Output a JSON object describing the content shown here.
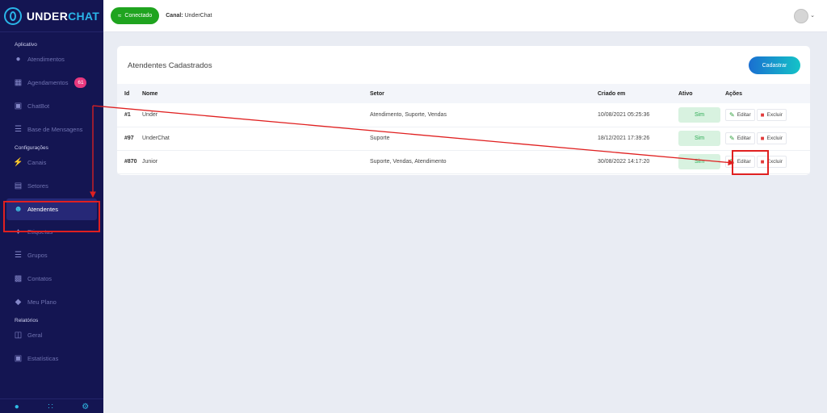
{
  "brand": {
    "part1": "UNDER",
    "part2": "CHAT"
  },
  "sidebar": {
    "sections": [
      {
        "title": "Aplicativo",
        "items": [
          {
            "label": "Atendimentos",
            "icon": "chat-icon"
          },
          {
            "label": "Agendamentos",
            "icon": "calendar-icon",
            "badge": "61"
          },
          {
            "label": "ChatBot",
            "icon": "robot-icon"
          },
          {
            "label": "Base de Mensagens",
            "icon": "database-icon"
          }
        ]
      },
      {
        "title": "Configurações",
        "items": [
          {
            "label": "Canais",
            "icon": "plug-icon"
          },
          {
            "label": "Setores",
            "icon": "server-icon"
          },
          {
            "label": "Atendentes",
            "icon": "user-icon",
            "active": true
          },
          {
            "label": "Etiquetas",
            "icon": "tags-icon"
          },
          {
            "label": "Grupos",
            "icon": "layers-icon"
          },
          {
            "label": "Contatos",
            "icon": "contact-card-icon"
          },
          {
            "label": "Meu Plano",
            "icon": "tag-icon"
          }
        ]
      },
      {
        "title": "Relatórios",
        "items": [
          {
            "label": "Geral",
            "icon": "presentation-icon"
          },
          {
            "label": "Estatísticas",
            "icon": "clipboard-icon"
          }
        ]
      }
    ]
  },
  "topbar": {
    "status_label": "Conectado",
    "channel_prefix": "Canal:",
    "channel_name": "UnderChat"
  },
  "card": {
    "title": "Atendentes Cadastrados",
    "add_button": "Cadastrar"
  },
  "table": {
    "headers": [
      "Id",
      "Nome",
      "Setor",
      "Criado em",
      "Ativo",
      "Ações"
    ],
    "rows": [
      {
        "id": "#1",
        "nome": "Under",
        "setor": "Atendimento, Suporte, Vendas",
        "criado": "10/08/2021 05:25:36",
        "ativo": "Sim"
      },
      {
        "id": "#97",
        "nome": "UnderChat",
        "setor": "Suporte",
        "criado": "18/12/2021 17:39:26",
        "ativo": "Sim"
      },
      {
        "id": "#870",
        "nome": "Junior",
        "setor": "Suporte, Vendas, Atendimento",
        "criado": "30/08/2022 14:17:20",
        "ativo": "Sim"
      }
    ],
    "edit_label": "Editar",
    "delete_label": "Excluir"
  },
  "colors": {
    "sidebar_bg": "#141552",
    "accent": "#2ab5e8",
    "success": "#1fa41f",
    "annotation": "#e02020"
  }
}
